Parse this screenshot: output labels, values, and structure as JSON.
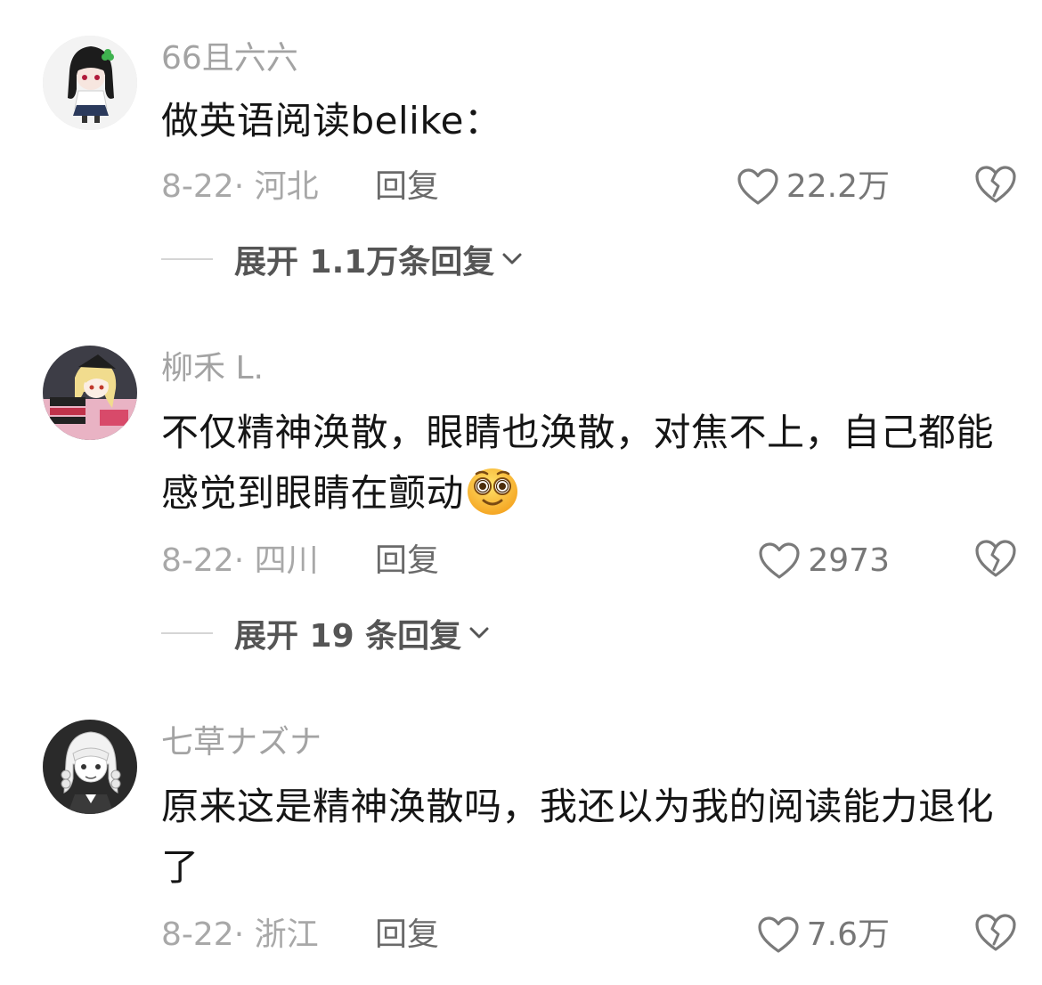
{
  "comments": [
    {
      "username": "66且六六",
      "text": "做英语阅读belike：",
      "time_location": "8-22· 河北",
      "reply_label": "回复",
      "likes": "22.2万",
      "expand_label": "展开 1.1万条回复",
      "avatar_icon": "anime-girl-avatar"
    },
    {
      "username": "柳禾 L.",
      "text": "不仅精神涣散，眼睛也涣散，对焦不上，自己都能感觉到眼睛在颤动",
      "time_location": "8-22· 四川",
      "reply_label": "回复",
      "likes": "2973",
      "expand_label": "展开 19 条回复",
      "avatar_icon": "anime-blonde-avatar",
      "emoji": "dizzy-face-emoji"
    },
    {
      "username": "七草ナズナ",
      "text": "原来这是精神涣散吗，我还以为我的阅读能力退化了",
      "time_location": "8-22· 浙江",
      "reply_label": "回复",
      "likes": "7.6万",
      "avatar_icon": "anime-monochrome-avatar"
    }
  ],
  "icons": {
    "like": "heart-outline-icon",
    "dislike": "broken-heart-icon",
    "expand": "chevron-down-icon"
  },
  "colors": {
    "username": "#a3a3a3",
    "text": "#151515",
    "meta": "#a8a8a8",
    "reply": "#6a6a6a"
  }
}
